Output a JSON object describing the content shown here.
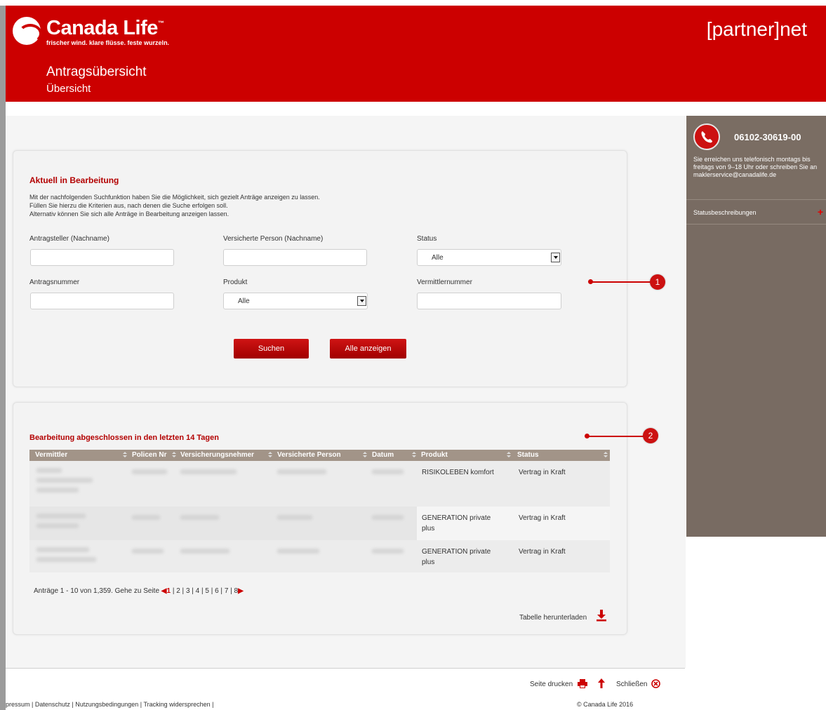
{
  "header": {
    "brand": "Canada Life",
    "brand_tm": "™",
    "tagline": "frischer wind. klare flüsse. feste wurzeln.",
    "portal": "[partner]net",
    "title": "Antragsübersicht",
    "subtitle": "Übersicht"
  },
  "search": {
    "heading": "Aktuell in Bearbeitung",
    "intro": [
      "Mit der nachfolgenden Suchfunktion haben Sie die Möglichkeit, sich gezielt Anträge anzeigen zu lassen.",
      "Füllen Sie hierzu die Kriterien aus, nach denen die Suche erfolgen soll.",
      "Alternativ können Sie sich alle Anträge in Bearbeitung anzeigen lassen."
    ],
    "fields": {
      "antragsteller_label": "Antragsteller (Nachname)",
      "versicherte_label": "Versicherte Person (Nachname)",
      "status_label": "Status",
      "status_value": "Alle",
      "antragsnummer_label": "Antragsnummer",
      "produkt_label": "Produkt",
      "produkt_value": "Alle",
      "vermittlernummer_label": "Vermittlernummer"
    },
    "search_button": "Suchen",
    "show_all_button": "Alle anzeigen"
  },
  "callouts": [
    "1",
    "2"
  ],
  "completed": {
    "heading": "Bearbeitung abgeschlossen in den letzten 14 Tagen",
    "columns": [
      "Vermittler",
      "Policen Nr",
      "Versicherungsnehmer",
      "Versicherte Person",
      "Datum",
      "Produkt",
      "Status"
    ],
    "rows": [
      {
        "produkt": "RISIKOLEBEN komfort",
        "produkt2": "",
        "status": "Vertrag in Kraft"
      },
      {
        "produkt": "GENERATION private",
        "produkt2": "plus",
        "status": "Vertrag in Kraft"
      },
      {
        "produkt": "GENERATION private",
        "produkt2": "plus",
        "status": "Vertrag in Kraft"
      }
    ],
    "pager_text": "Anträge 1 - 10 von 1,359. Gehe zu Seite",
    "pages": [
      "1",
      "2",
      "3",
      "4",
      "5",
      "6",
      "7",
      "8"
    ],
    "download": "Tabelle herunterladen"
  },
  "sidebar": {
    "phone": "06102-30619-00",
    "contact_text": "Sie erreichen uns telefonisch montags bis freitags von 9–18 Uhr oder schreiben Sie an maklerservice@canadalife.de",
    "status_link": "Statusbeschreibungen",
    "plus": "+"
  },
  "footer": {
    "print": "Seite drucken",
    "close": "Schließen",
    "links": "pressum | Datenschutz | Nutzungsbedingungen | Tracking widersprechen |",
    "copyright": "© Canada Life 2016"
  },
  "colors": {
    "brand_red": "#cc0000",
    "sidebar_brown": "#786b62",
    "table_header": "#a29488"
  }
}
